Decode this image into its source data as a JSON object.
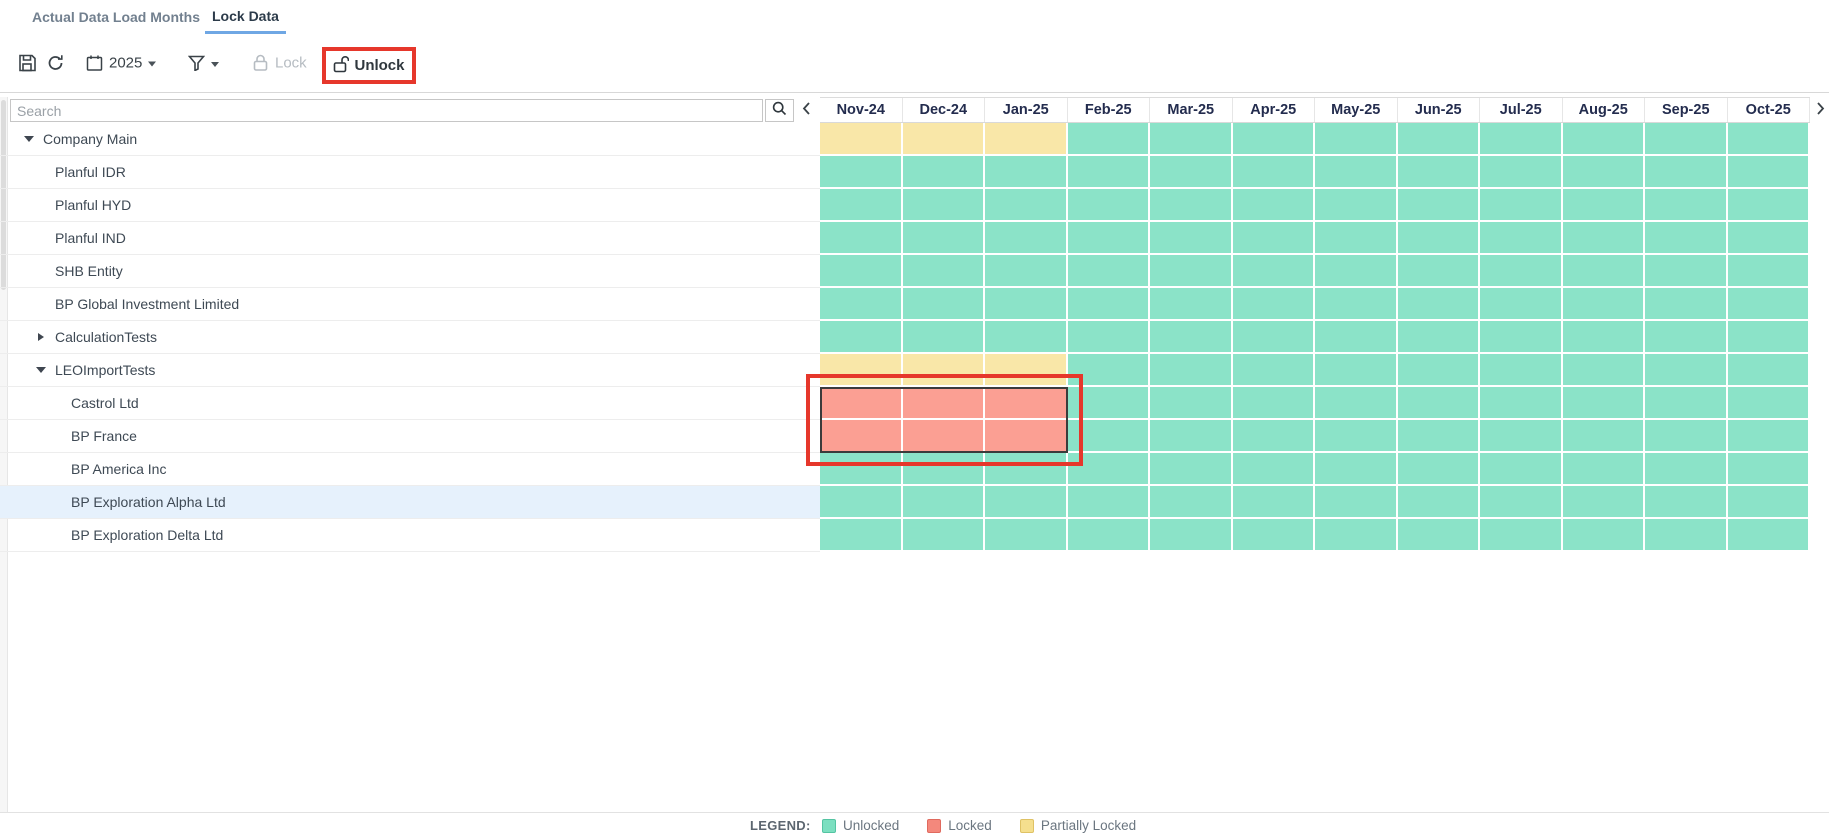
{
  "tabs": {
    "items": [
      {
        "label": "Actual Data Load Months",
        "active": false
      },
      {
        "label": "Lock Data",
        "active": true
      }
    ]
  },
  "toolbar": {
    "year": "2025",
    "lock_label": "Lock",
    "unlock_label": "Unlock"
  },
  "search": {
    "placeholder": "Search"
  },
  "months": [
    "Nov-24",
    "Dec-24",
    "Jan-25",
    "Feb-25",
    "Mar-25",
    "Apr-25",
    "May-25",
    "Jun-25",
    "Jul-25",
    "Aug-25",
    "Sep-25",
    "Oct-25"
  ],
  "colors": {
    "unlocked": "#8be3c8",
    "locked": "#fb9f93",
    "partially_locked": "#f9e7a8",
    "selected_row": "#e6f1fc",
    "annotation_red": "#e6372b",
    "active_tab_underline": "#6fa7e4",
    "header_text": "#232c4e"
  },
  "icons": {
    "save": "floppy-disk",
    "refresh": "circular-arrows",
    "calendar": "calendar",
    "filter": "funnel",
    "lock": "closed-padlock",
    "unlock": "open-padlock",
    "search": "magnifier",
    "pan_left": "chevron-left",
    "pan_right": "chevron-right"
  },
  "rows": [
    {
      "label": "Company Main",
      "level": 0,
      "expand": "expanded",
      "selected": false,
      "cells": [
        "P",
        "P",
        "P",
        "U",
        "U",
        "U",
        "U",
        "U",
        "U",
        "U",
        "U",
        "U"
      ]
    },
    {
      "label": "Planful IDR",
      "level": 1,
      "expand": null,
      "selected": false,
      "cells": [
        "U",
        "U",
        "U",
        "U",
        "U",
        "U",
        "U",
        "U",
        "U",
        "U",
        "U",
        "U"
      ]
    },
    {
      "label": "Planful HYD",
      "level": 1,
      "expand": null,
      "selected": false,
      "cells": [
        "U",
        "U",
        "U",
        "U",
        "U",
        "U",
        "U",
        "U",
        "U",
        "U",
        "U",
        "U"
      ]
    },
    {
      "label": "Planful IND",
      "level": 1,
      "expand": null,
      "selected": false,
      "cells": [
        "U",
        "U",
        "U",
        "U",
        "U",
        "U",
        "U",
        "U",
        "U",
        "U",
        "U",
        "U"
      ]
    },
    {
      "label": "SHB Entity",
      "level": 1,
      "expand": null,
      "selected": false,
      "cells": [
        "U",
        "U",
        "U",
        "U",
        "U",
        "U",
        "U",
        "U",
        "U",
        "U",
        "U",
        "U"
      ]
    },
    {
      "label": "BP Global Investment Limited",
      "level": 1,
      "expand": null,
      "selected": false,
      "cells": [
        "U",
        "U",
        "U",
        "U",
        "U",
        "U",
        "U",
        "U",
        "U",
        "U",
        "U",
        "U"
      ]
    },
    {
      "label": "CalculationTests",
      "level": 1,
      "expand": "collapsed",
      "selected": false,
      "cells": [
        "U",
        "U",
        "U",
        "U",
        "U",
        "U",
        "U",
        "U",
        "U",
        "U",
        "U",
        "U"
      ]
    },
    {
      "label": "LEOImportTests",
      "level": 1,
      "expand": "expanded",
      "selected": false,
      "cells": [
        "P",
        "P",
        "P",
        "U",
        "U",
        "U",
        "U",
        "U",
        "U",
        "U",
        "U",
        "U"
      ]
    },
    {
      "label": "Castrol Ltd",
      "level": 2,
      "expand": null,
      "selected": false,
      "cells": [
        "L",
        "L",
        "L",
        "U",
        "U",
        "U",
        "U",
        "U",
        "U",
        "U",
        "U",
        "U"
      ]
    },
    {
      "label": "BP France",
      "level": 2,
      "expand": null,
      "selected": false,
      "cells": [
        "L",
        "L",
        "L",
        "U",
        "U",
        "U",
        "U",
        "U",
        "U",
        "U",
        "U",
        "U"
      ]
    },
    {
      "label": "BP America Inc",
      "level": 2,
      "expand": null,
      "selected": false,
      "cells": [
        "U",
        "U",
        "U",
        "U",
        "U",
        "U",
        "U",
        "U",
        "U",
        "U",
        "U",
        "U"
      ]
    },
    {
      "label": "BP Exploration Alpha Ltd",
      "level": 2,
      "expand": null,
      "selected": true,
      "cells": [
        "U",
        "U",
        "U",
        "U",
        "U",
        "U",
        "U",
        "U",
        "U",
        "U",
        "U",
        "U"
      ]
    },
    {
      "label": "BP Exploration Delta Ltd",
      "level": 2,
      "expand": null,
      "selected": false,
      "cells": [
        "U",
        "U",
        "U",
        "U",
        "U",
        "U",
        "U",
        "U",
        "U",
        "U",
        "U",
        "U"
      ]
    }
  ],
  "legend": {
    "title": "LEGEND:",
    "items": [
      {
        "label": "Unlocked",
        "state": "unlocked"
      },
      {
        "label": "Locked",
        "state": "locked"
      },
      {
        "label": "Partially Locked",
        "state": "partially_locked"
      }
    ]
  }
}
